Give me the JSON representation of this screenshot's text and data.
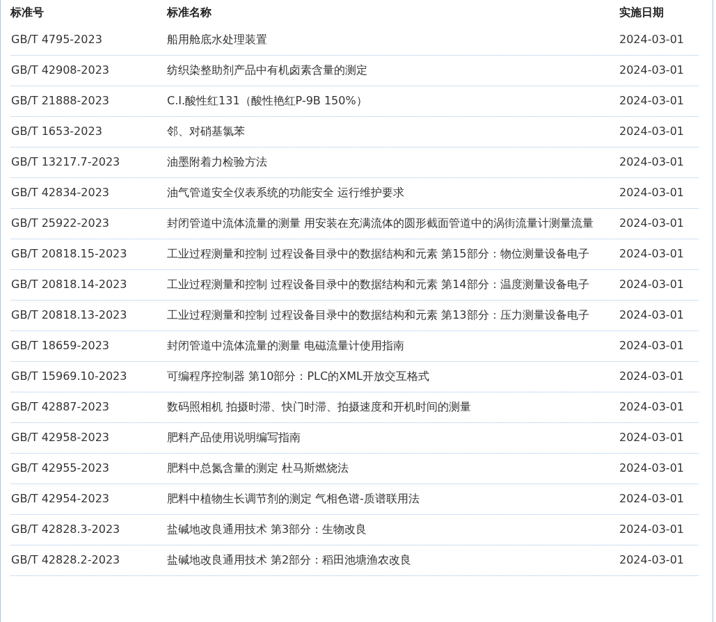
{
  "table": {
    "columns": [
      "标准号",
      "标准名称",
      "实施日期"
    ],
    "rows": [
      {
        "code": "GB/T 4795-2023",
        "name": "船用舱底水处理装置",
        "date": "2024-03-01"
      },
      {
        "code": "GB/T 42908-2023",
        "name": "纺织染整助剂产品中有机卤素含量的测定",
        "date": "2024-03-01"
      },
      {
        "code": "GB/T 21888-2023",
        "name": "C.I.酸性红131（酸性艳红P-9B 150%）",
        "date": "2024-03-01"
      },
      {
        "code": "GB/T 1653-2023",
        "name": "邻、对硝基氯苯",
        "date": "2024-03-01"
      },
      {
        "code": "GB/T 13217.7-2023",
        "name": "油墨附着力检验方法",
        "date": "2024-03-01"
      },
      {
        "code": "GB/T 42834-2023",
        "name": "油气管道安全仪表系统的功能安全 运行维护要求",
        "date": "2024-03-01"
      },
      {
        "code": "GB/T 25922-2023",
        "name": "封闭管道中流体流量的测量 用安装在充满流体的圆形截面管道中的涡街流量计测量流量",
        "date": "2024-03-01"
      },
      {
        "code": "GB/T 20818.15-2023",
        "name": "工业过程测量和控制 过程设备目录中的数据结构和元素 第15部分：物位测量设备电子",
        "date": "2024-03-01"
      },
      {
        "code": "GB/T 20818.14-2023",
        "name": "工业过程测量和控制 过程设备目录中的数据结构和元素 第14部分：温度测量设备电子",
        "date": "2024-03-01"
      },
      {
        "code": "GB/T 20818.13-2023",
        "name": "工业过程测量和控制 过程设备目录中的数据结构和元素 第13部分：压力测量设备电子",
        "date": "2024-03-01"
      },
      {
        "code": "GB/T 18659-2023",
        "name": "封闭管道中流体流量的测量 电磁流量计使用指南",
        "date": "2024-03-01"
      },
      {
        "code": "GB/T 15969.10-2023",
        "name": "可编程序控制器 第10部分：PLC的XML开放交互格式",
        "date": "2024-03-01"
      },
      {
        "code": "GB/T 42887-2023",
        "name": "数码照相机 拍摄时滞、快门时滞、拍摄速度和开机时间的测量",
        "date": "2024-03-01"
      },
      {
        "code": "GB/T 42958-2023",
        "name": "肥料产品使用说明编写指南",
        "date": "2024-03-01"
      },
      {
        "code": "GB/T 42955-2023",
        "name": "肥料中总氮含量的测定 杜马斯燃烧法",
        "date": "2024-03-01"
      },
      {
        "code": "GB/T 42954-2023",
        "name": "肥料中植物生长调节剂的测定 气相色谱-质谱联用法",
        "date": "2024-03-01"
      },
      {
        "code": "GB/T 42828.3-2023",
        "name": "盐碱地改良通用技术 第3部分：生物改良",
        "date": "2024-03-01"
      },
      {
        "code": "GB/T 42828.2-2023",
        "name": "盐碱地改良通用技术 第2部分：稻田池塘渔农改良",
        "date": "2024-03-01"
      }
    ]
  }
}
